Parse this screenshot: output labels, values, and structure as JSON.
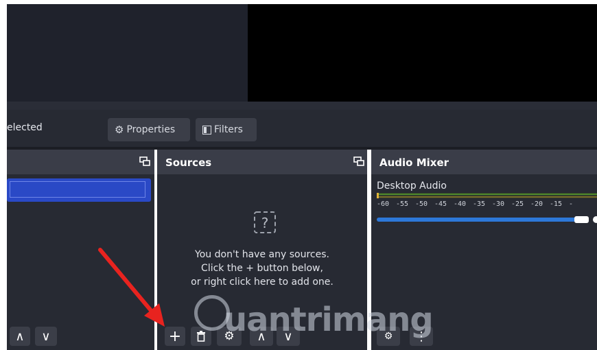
{
  "toolbar": {
    "selected_label": "elected",
    "properties_label": "Properties",
    "filters_label": "Filters"
  },
  "docks": {
    "sources": {
      "title": "Sources",
      "empty_line1": "You don't have any sources.",
      "empty_line2": "Click the + button below,",
      "empty_line3": "or right click here to add one."
    },
    "audio_mixer": {
      "title": "Audio Mixer",
      "channel_label": "Desktop Audio",
      "meter_ticks": [
        "-60",
        "-55",
        "-50",
        "-45",
        "-40",
        "-35",
        "-30",
        "-25",
        "-20",
        "-15",
        "-"
      ],
      "volume_level": 0.92
    }
  },
  "controls": {
    "add": "+",
    "up": "∧",
    "down": "∨",
    "menu": "⋮"
  },
  "watermark": {
    "text": "uantrimang"
  },
  "colors": {
    "scene_selected": "#2a49c6",
    "slider": "#2d78d8",
    "annotation_arrow": "#e8231f"
  }
}
